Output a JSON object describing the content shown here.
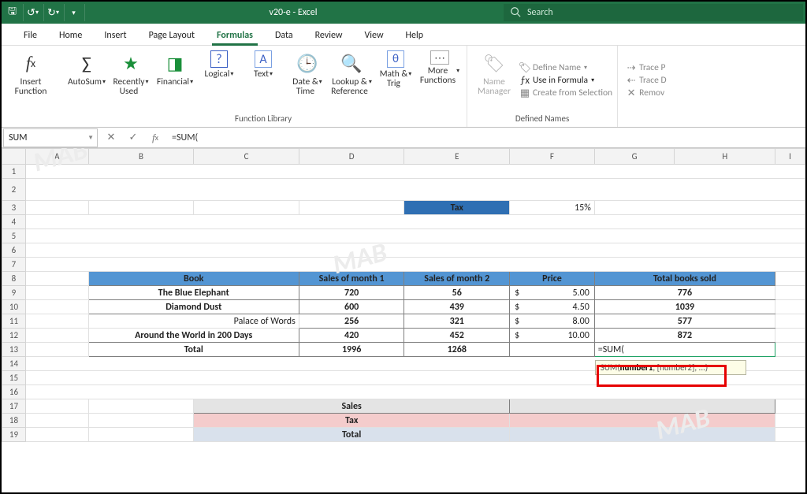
{
  "title": "v20-e  -  Excel",
  "search": {
    "placeholder": "Search"
  },
  "menu": [
    "File",
    "Home",
    "Insert",
    "Page Layout",
    "Formulas",
    "Data",
    "Review",
    "View",
    "Help"
  ],
  "activeTab": "Formulas",
  "ribbon": {
    "insertFunction": "Insert\nFunction",
    "autosum": "AutoSum",
    "recently": "Recently\nUsed",
    "financial": "Financial",
    "logical": "Logical",
    "text": "Text",
    "datetime": "Date &\nTime",
    "lookup": "Lookup &\nReference",
    "math": "Math &\nTrig",
    "more": "More\nFunctions",
    "nameMgr": "Name\nManager",
    "defineName": "Define Name",
    "useInFormula": "Use in Formula",
    "createSel": "Create from Selection",
    "traceP": "Trace P",
    "traceD": "Trace D",
    "remov": "Remov",
    "groupLib": "Function Library",
    "groupNames": "Defined Names"
  },
  "namebox": "SUM",
  "formula": "=SUM(",
  "cols": [
    "A",
    "B",
    "C",
    "D",
    "E",
    "F",
    "G",
    "H",
    "I"
  ],
  "rownums": [
    1,
    2,
    3,
    4,
    5,
    6,
    7,
    8,
    9,
    10,
    11,
    12,
    13,
    14,
    15,
    16,
    17,
    18,
    19
  ],
  "labels": {
    "tax": "Tax",
    "taxv": "15%",
    "hBook": "Book",
    "hS1": "Sales of month 1",
    "hS2": "Sales of month 2",
    "hPrice": "Price",
    "hTotal": "Total books sold",
    "total": "Total",
    "sales17": "Sales",
    "tax18": "Tax",
    "total19": "Total",
    "editing": "=SUM(",
    "tooltipHead": "SUM(",
    "tooltipBold": "number1",
    "tooltipRest": ", [number2], ...)"
  },
  "data": {
    "rows": [
      {
        "book": "The Blue Elephant",
        "s1": 720,
        "s2": 56,
        "price": "5.00",
        "total": 776
      },
      {
        "book": "Diamond Dust",
        "s1": 600,
        "s2": 439,
        "price": "4.50",
        "total": 1039
      },
      {
        "book": "Palace of Words",
        "s1": 256,
        "s2": 321,
        "price": "8.00",
        "total": 577
      },
      {
        "book": "Around the World in 200 Days",
        "s1": 420,
        "s2": 452,
        "price": "10.00",
        "total": 872
      }
    ],
    "totals": {
      "s1": 1996,
      "s2": 1268
    }
  },
  "colors": {
    "brand": "#217346",
    "blueHeader": "#5395d3",
    "red": "#e60000"
  }
}
